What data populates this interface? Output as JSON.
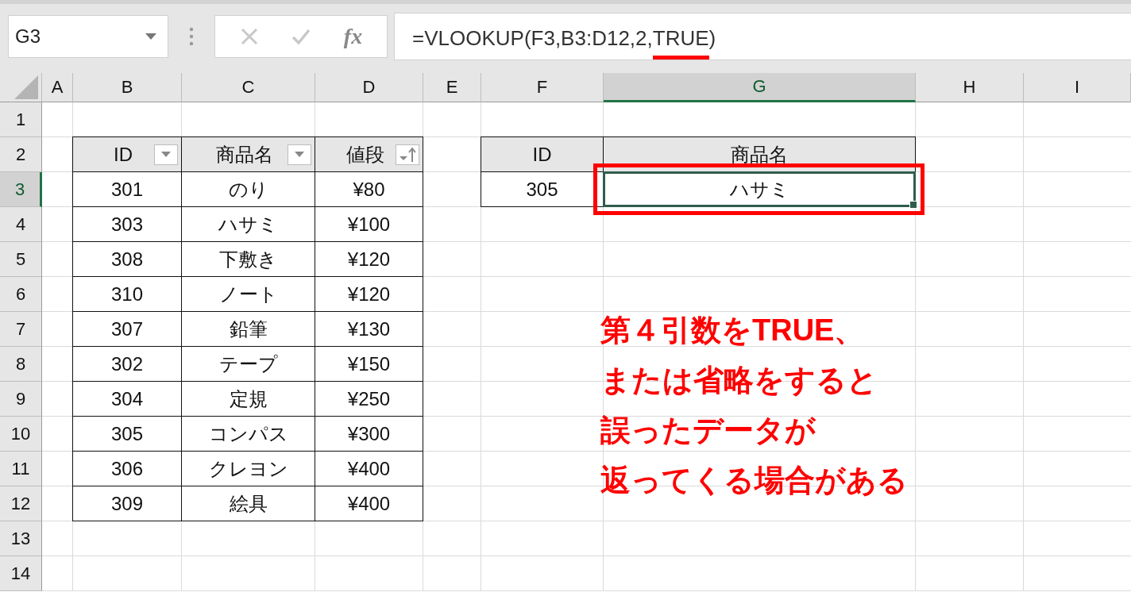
{
  "formula_bar": {
    "name_box": "G3",
    "function_button": "fx",
    "formula_parts": [
      {
        "text": "=VLOOKUP(F3,B3:D12,2,",
        "underlined": false
      },
      {
        "text": "TRUE",
        "underlined": true
      },
      {
        "text": ")",
        "underlined": false
      }
    ]
  },
  "column_headers": [
    {
      "label": "A",
      "selected": false
    },
    {
      "label": "B",
      "selected": false
    },
    {
      "label": "C",
      "selected": false
    },
    {
      "label": "D",
      "selected": false
    },
    {
      "label": "E",
      "selected": false
    },
    {
      "label": "F",
      "selected": false
    },
    {
      "label": "G",
      "selected": true
    },
    {
      "label": "H",
      "selected": false
    },
    {
      "label": "I",
      "selected": false
    }
  ],
  "row_headers": [
    {
      "label": "1",
      "selected": false
    },
    {
      "label": "2",
      "selected": false
    },
    {
      "label": "3",
      "selected": true
    },
    {
      "label": "4",
      "selected": false
    },
    {
      "label": "5",
      "selected": false
    },
    {
      "label": "6",
      "selected": false
    },
    {
      "label": "7",
      "selected": false
    },
    {
      "label": "8",
      "selected": false
    },
    {
      "label": "9",
      "selected": false
    },
    {
      "label": "10",
      "selected": false
    },
    {
      "label": "11",
      "selected": false
    },
    {
      "label": "12",
      "selected": false
    },
    {
      "label": "13",
      "selected": false
    },
    {
      "label": "14",
      "selected": false
    }
  ],
  "product_table": {
    "columns": [
      {
        "label": "ID",
        "kind": "dropdown"
      },
      {
        "label": "商品名",
        "kind": "dropdown"
      },
      {
        "label": "値段",
        "kind": "sorted"
      }
    ],
    "rows": [
      [
        "301",
        "のり",
        "¥80"
      ],
      [
        "303",
        "ハサミ",
        "¥100"
      ],
      [
        "308",
        "下敷き",
        "¥120"
      ],
      [
        "310",
        "ノート",
        "¥120"
      ],
      [
        "307",
        "鉛筆",
        "¥130"
      ],
      [
        "302",
        "テープ",
        "¥150"
      ],
      [
        "304",
        "定規",
        "¥250"
      ],
      [
        "305",
        "コンパス",
        "¥300"
      ],
      [
        "306",
        "クレヨン",
        "¥400"
      ],
      [
        "309",
        "絵具",
        "¥400"
      ]
    ]
  },
  "lookup_table": {
    "columns": [
      "ID",
      "商品名"
    ],
    "rows": [
      {
        "id": "305",
        "name": "ハサミ",
        "name_selected": true,
        "outlined": true
      }
    ]
  },
  "annotation": {
    "lines": [
      "第４引数をTRUE、",
      "または省略をすると",
      "誤ったデータが",
      "返ってくる場合がある"
    ]
  }
}
